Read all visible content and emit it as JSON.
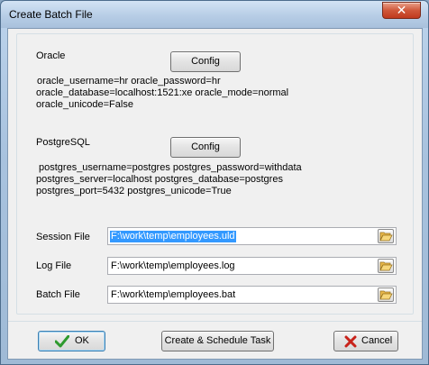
{
  "window": {
    "title": "Create Batch File",
    "close_label": "✕"
  },
  "oracle": {
    "heading": "Oracle",
    "config_label": "Config",
    "lines": [
      "oracle_username=hr oracle_password=hr",
      "oracle_database=localhost:1521:xe oracle_mode=normal",
      "oracle_unicode=False"
    ]
  },
  "postgres": {
    "heading": "PostgreSQL",
    "config_label": "Config",
    "lines": [
      "postgres_username=postgres postgres_password=withdata",
      "postgres_server=localhost postgres_database=postgres",
      "postgres_port=5432 postgres_unicode=True"
    ]
  },
  "files": {
    "session_label": "Session File",
    "session_value": "F:\\work\\temp\\employees.uld",
    "log_label": "Log File",
    "log_value": "F:\\work\\temp\\employees.log",
    "batch_label": "Batch File",
    "batch_value": "F:\\work\\temp\\employees.bat"
  },
  "actions": {
    "ok_label": "OK",
    "schedule_label": "Create & Schedule Task",
    "cancel_label": "Cancel"
  },
  "colors": {
    "selection": "#3399ff",
    "ok_check": "#2e9a2e",
    "cancel_x": "#c8221a"
  }
}
